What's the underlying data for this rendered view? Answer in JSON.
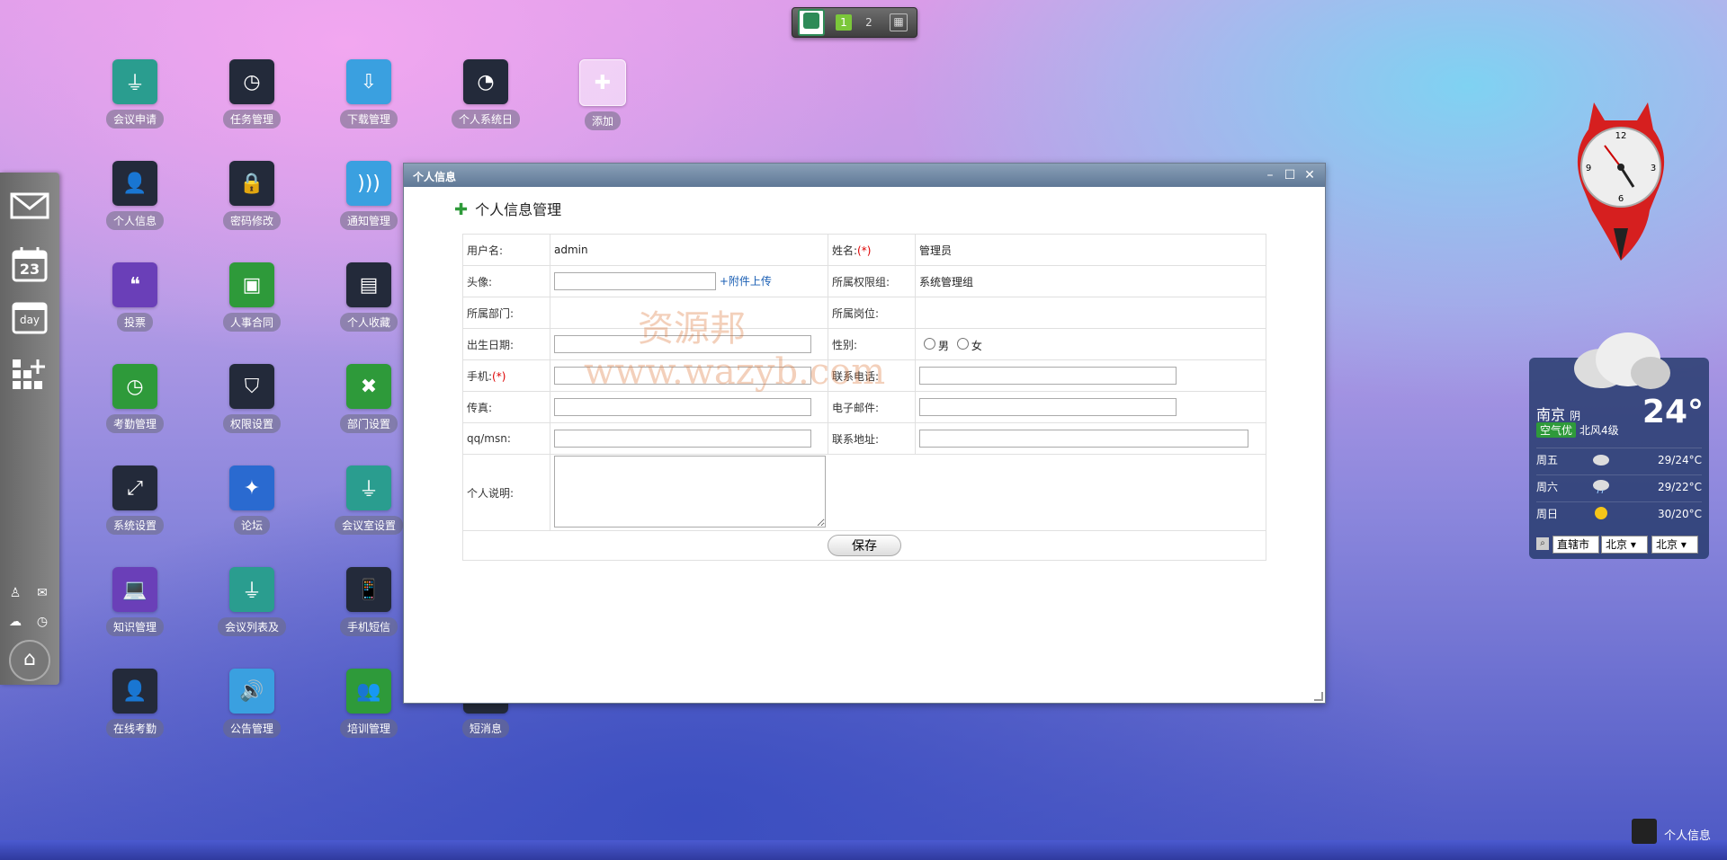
{
  "topbar": {
    "pages": [
      "1",
      "2"
    ],
    "active_page": "1"
  },
  "desktop_icons": [
    {
      "id": "meeting-apply",
      "label": "会议申请",
      "color": "#2a9d8f",
      "icon": "plug-icon"
    },
    {
      "id": "task",
      "label": "任务管理",
      "color": "#232a3a",
      "icon": "clock-icon"
    },
    {
      "id": "download",
      "label": "下载管理",
      "color": "#3aa0e0",
      "icon": "download-icon"
    },
    {
      "id": "personal-log",
      "label": "个人系统日",
      "color": "#232a3a",
      "icon": "pie-icon"
    },
    {
      "id": "add",
      "label": "添加",
      "color": "transparent",
      "icon": "plus-icon"
    },
    {
      "id": "personal-info",
      "label": "个人信息",
      "color": "#232a3a",
      "icon": "user-icon"
    },
    {
      "id": "password",
      "label": "密码修改",
      "color": "#232a3a",
      "icon": "lock-icon"
    },
    {
      "id": "notice",
      "label": "通知管理",
      "color": "#3aa0e0",
      "icon": "signal-icon"
    },
    {
      "id": "vote",
      "label": "投票",
      "color": "#6a3fb8",
      "icon": "quote-icon"
    },
    {
      "id": "hr-contract",
      "label": "人事合同",
      "color": "#2e9a3a",
      "icon": "windows-icon"
    },
    {
      "id": "favorites",
      "label": "个人收藏",
      "color": "#232a3a",
      "icon": "card-icon"
    },
    {
      "id": "attendance",
      "label": "考勤管理",
      "color": "#2e9a3a",
      "icon": "clock-icon"
    },
    {
      "id": "permission",
      "label": "权限设置",
      "color": "#232a3a",
      "icon": "shield-icon"
    },
    {
      "id": "dept",
      "label": "部门设置",
      "color": "#2e9a3a",
      "icon": "xbox-icon"
    },
    {
      "id": "system",
      "label": "系统设置",
      "color": "#232a3a",
      "icon": "resize-icon"
    },
    {
      "id": "forum",
      "label": "论坛",
      "color": "#2a6ad0",
      "icon": "person-icon"
    },
    {
      "id": "meeting-room",
      "label": "会议室设置",
      "color": "#2a9d8f",
      "icon": "plug-icon"
    },
    {
      "id": "knowledge",
      "label": "知识管理",
      "color": "#6a3fb8",
      "icon": "laptop-icon"
    },
    {
      "id": "meeting-list",
      "label": "会议列表及",
      "color": "#2a9d8f",
      "icon": "plug-icon"
    },
    {
      "id": "sms",
      "label": "手机短信",
      "color": "#232a3a",
      "icon": "phone-icon"
    },
    {
      "id": "online-att",
      "label": "在线考勤",
      "color": "#232a3a",
      "icon": "user-icon"
    },
    {
      "id": "announce",
      "label": "公告管理",
      "color": "#3aa0e0",
      "icon": "speaker-icon"
    },
    {
      "id": "training",
      "label": "培训管理",
      "color": "#2e9a3a",
      "icon": "group-icon"
    },
    {
      "id": "short-msg",
      "label": "短消息",
      "color": "#232a3a",
      "icon": "mail-icon"
    }
  ],
  "dock": {
    "items": [
      "mail-icon",
      "calendar-icon",
      "day-icon",
      "apps-icon"
    ],
    "calendar_day": "23",
    "day_label": "day"
  },
  "window": {
    "title": "个人信息",
    "heading": "个人信息管理",
    "form": {
      "username_label": "用户名:",
      "username_value": "admin",
      "name_label": "姓名:",
      "name_req": "(*)",
      "name_value": "管理员",
      "avatar_label": "头像:",
      "avatar_upload": "+附件上传",
      "role_group_label": "所属权限组:",
      "role_group_value": "系统管理组",
      "dept_label": "所属部门:",
      "dept_value": "",
      "post_label": "所属岗位:",
      "post_value": "",
      "birth_label": "出生日期:",
      "gender_label": "性别:",
      "gender_male": "男",
      "gender_female": "女",
      "mobile_label": "手机:",
      "mobile_req": "(*)",
      "phone_label": "联系电话:",
      "fax_label": "传真:",
      "email_label": "电子邮件:",
      "qq_label": "qq/msn:",
      "address_label": "联系地址:",
      "desc_label": "个人说明:",
      "save_label": "保存"
    },
    "watermark_line1": "资源邦",
    "watermark_line2": "www.wazyb.com"
  },
  "clock": {
    "numbers": [
      "12",
      "3",
      "6",
      "9"
    ]
  },
  "weather": {
    "city": "南京",
    "condition": "阴",
    "aqi": "空气优",
    "wind": "北风4级",
    "temp": "24°",
    "forecast": [
      {
        "day": "周五",
        "temp": "29/24°C",
        "icon": "cloud-icon"
      },
      {
        "day": "周六",
        "temp": "29/22°C",
        "icon": "cloud-rain-icon"
      },
      {
        "day": "周日",
        "temp": "30/20°C",
        "icon": "sun-icon"
      }
    ],
    "selects": [
      "直辖市",
      "北京",
      "北京"
    ]
  },
  "taskbar": {
    "item_label": "个人信息"
  }
}
